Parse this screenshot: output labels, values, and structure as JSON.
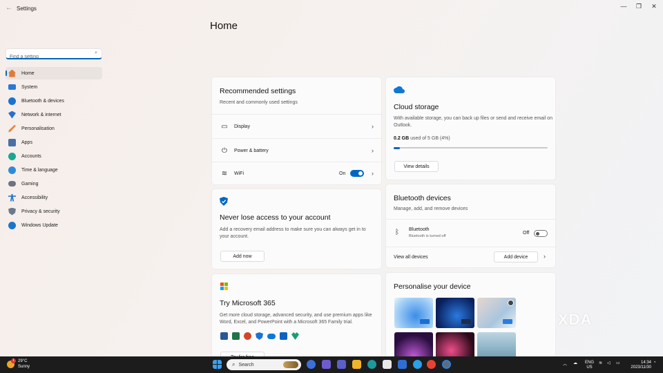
{
  "window": {
    "title": "Settings",
    "back_glyph": "←",
    "minimize_glyph": "—",
    "maximize_glyph": "❐",
    "close_glyph": "✕"
  },
  "search": {
    "placeholder": "Find a setting",
    "icon": "search-icon"
  },
  "sidebar": {
    "items": [
      {
        "label": "Home",
        "icon": "home-icon",
        "active": true
      },
      {
        "label": "System",
        "icon": "system-icon"
      },
      {
        "label": "Bluetooth & devices",
        "icon": "bluetooth-icon"
      },
      {
        "label": "Network & internet",
        "icon": "network-icon"
      },
      {
        "label": "Personalisation",
        "icon": "brush-icon"
      },
      {
        "label": "Apps",
        "icon": "apps-icon"
      },
      {
        "label": "Accounts",
        "icon": "accounts-icon"
      },
      {
        "label": "Time & language",
        "icon": "time-icon"
      },
      {
        "label": "Gaming",
        "icon": "gaming-icon"
      },
      {
        "label": "Accessibility",
        "icon": "accessibility-icon"
      },
      {
        "label": "Privacy & security",
        "icon": "shield-icon"
      },
      {
        "label": "Windows Update",
        "icon": "update-icon"
      }
    ]
  },
  "main": {
    "title": "Home"
  },
  "recommended": {
    "title": "Recommended settings",
    "subtitle": "Recent and commonly used settings",
    "rows": [
      {
        "label": "Display",
        "icon": "display-icon"
      },
      {
        "label": "Power & battery",
        "icon": "power-icon"
      },
      {
        "label": "WiFi",
        "icon": "wifi-icon",
        "state": "On"
      }
    ]
  },
  "account": {
    "title": "Never lose access to your account",
    "description": "Add a recovery email address to make sure you can always get in to your account.",
    "button": "Add now"
  },
  "m365": {
    "title": "Try Microsoft 365",
    "description": "Get more cloud storage, advanced security, and use premium apps like Word, Excel, and PowerPoint with a Microsoft 365 Family trial.",
    "button": "Try for free"
  },
  "cloud": {
    "title": "Cloud storage",
    "description": "With available storage, you can back up files or send and receive email on Outlook.",
    "used": "0.2 GB",
    "of_text": " used of 5 GB (4%)",
    "fraction": 0.04,
    "button": "View details"
  },
  "bluetooth": {
    "title": "Bluetooth devices",
    "subtitle": "Manage, add, and remove devices",
    "device_label": "Bluetooth",
    "device_status": "Bluetooth is turned off",
    "state": "Off",
    "view_all": "View all devices",
    "add_button": "Add device"
  },
  "personalise": {
    "title": "Personalise your device"
  },
  "taskbar": {
    "weather_temp": "29°C",
    "weather_desc": "Sunny",
    "weather_badge": "1",
    "search_label": "Search",
    "lang_line1": "ENG",
    "lang_line2": "US",
    "time": "14:34",
    "date": "2023/11/30"
  },
  "watermark": "XDA",
  "colors": {
    "accent": "#0067c0"
  }
}
